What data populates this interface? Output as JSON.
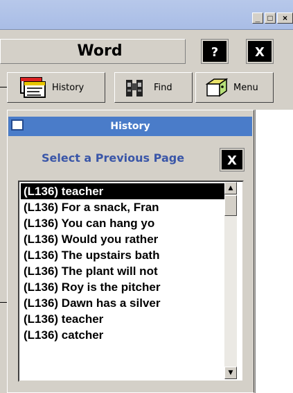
{
  "window": {
    "minimize_glyph": "_",
    "maximize_glyph": "□",
    "close_glyph": "×"
  },
  "header": {
    "title": "Word",
    "help_label": "?",
    "close_label": "X"
  },
  "toolbar": {
    "history_label": "History",
    "find_label": "Find",
    "menu_label": "Menu"
  },
  "dialog": {
    "title": "History",
    "subtitle": "Select a Previous Page",
    "close_label": "X",
    "items": [
      "(L136)  teacher",
      "(L136)  For a snack, Fran",
      "(L136)  You can hang yo",
      "(L136)  Would you rather",
      "(L136)  The upstairs bath",
      "(L136)  The plant will not",
      "(L136)  Roy is the pitcher",
      "(L136)  Dawn has a silver",
      "(L136)  teacher",
      "(L136)  catcher"
    ],
    "selected_index": 0,
    "scroll_up_glyph": "▲",
    "scroll_down_glyph": "▼"
  },
  "colors": {
    "dialog_title_bg": "#4a7cc9",
    "subtitle_text": "#3a56a8",
    "window_title_bg": "#b7c8ea"
  }
}
